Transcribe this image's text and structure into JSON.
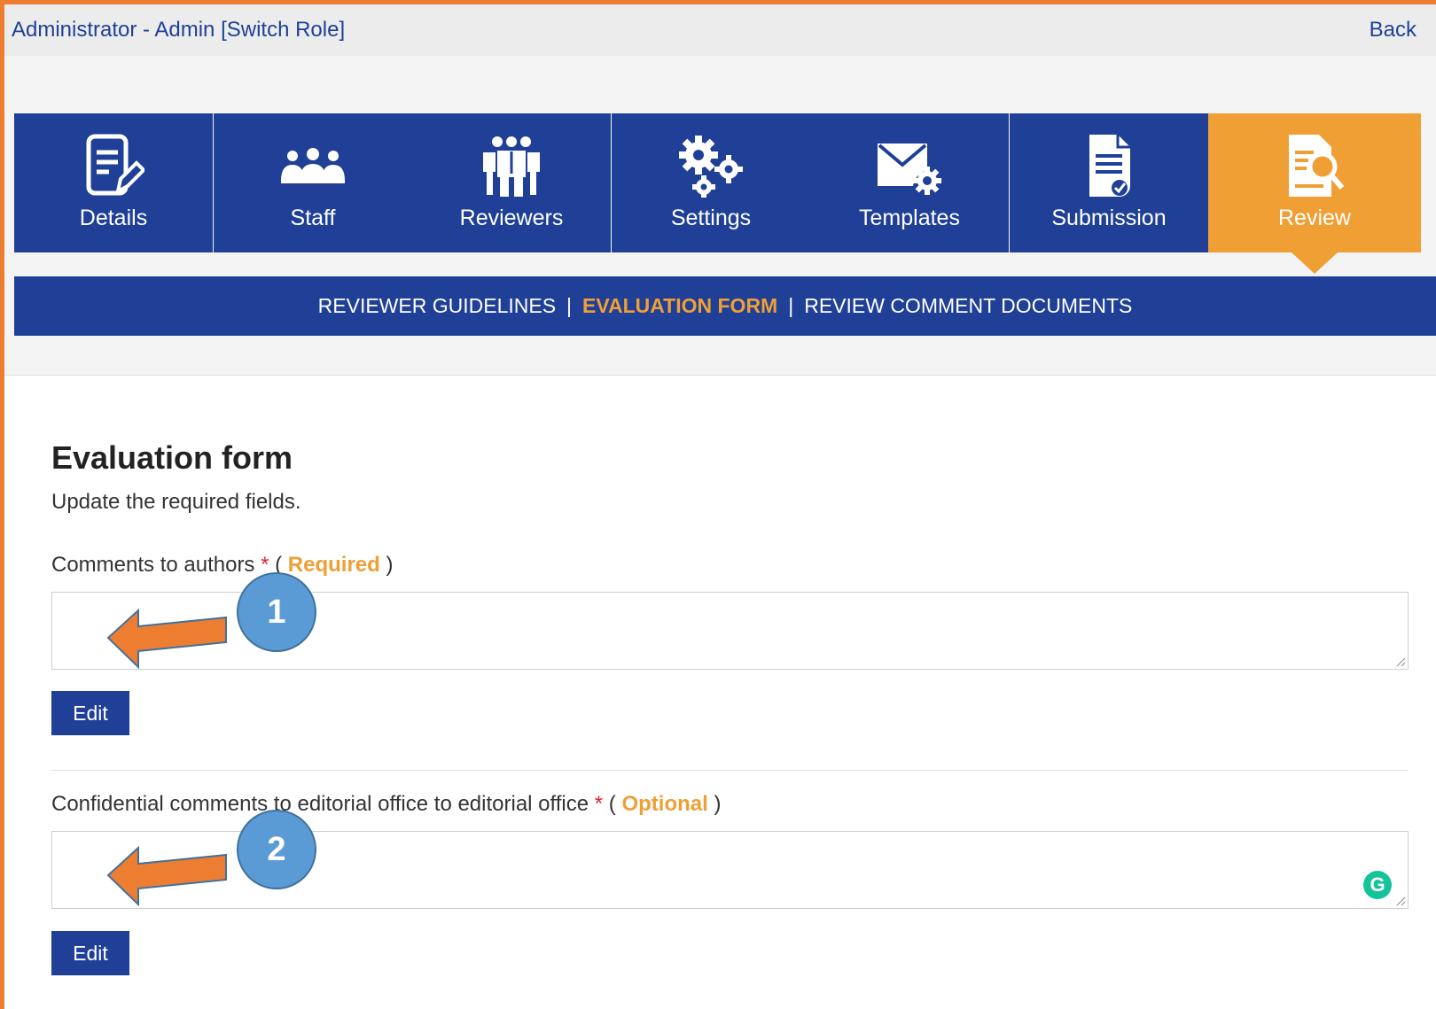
{
  "topbar": {
    "role_text": "Administrator - Admin [Switch Role]",
    "back_label": "Back"
  },
  "tabs": [
    {
      "label": "Details",
      "icon": "document-edit-icon"
    },
    {
      "label": "Staff",
      "icon": "staff-group-icon"
    },
    {
      "label": "Reviewers",
      "icon": "reviewers-group-icon"
    },
    {
      "label": "Settings",
      "icon": "gears-icon"
    },
    {
      "label": "Templates",
      "icon": "envelope-gear-icon"
    },
    {
      "label": "Submission",
      "icon": "document-check-icon"
    },
    {
      "label": "Review",
      "icon": "document-search-icon"
    }
  ],
  "active_tab": "Review",
  "subnav": {
    "items": [
      "REVIEWER GUIDELINES",
      "EVALUATION FORM",
      "REVIEW COMMENT DOCUMENTS"
    ],
    "separator": "|",
    "active": "EVALUATION FORM"
  },
  "form": {
    "title": "Evaluation form",
    "subtitle": "Update the required fields.",
    "fields": [
      {
        "label": "Comments to authors",
        "star": "*",
        "paren_open": "(",
        "tag": "Required",
        "paren_close": ")",
        "value": "",
        "edit_label": "Edit"
      },
      {
        "label": "Confidential comments to editorial office to editorial office",
        "star": "*",
        "paren_open": "(",
        "tag": "Optional",
        "paren_close": ")",
        "value": "",
        "edit_label": "Edit"
      }
    ]
  },
  "callouts": [
    "1",
    "2"
  ],
  "grammarly_glyph": "G",
  "colors": {
    "primary": "#1f4096",
    "accent": "#f09f35",
    "required": "#e02424",
    "annotation_frame": "#ed7d31",
    "callout_fill": "#5b9bd5"
  }
}
